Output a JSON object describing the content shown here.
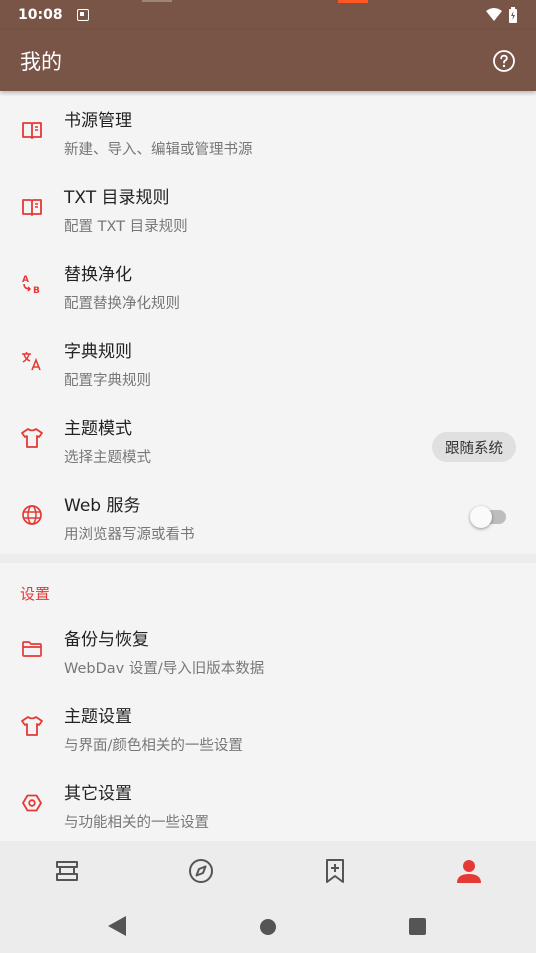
{
  "status_bar": {
    "time": "10:08"
  },
  "app_bar": {
    "title": "我的"
  },
  "rows": [
    {
      "title": "书源管理",
      "subtitle": "新建、导入、编辑或管理书源"
    },
    {
      "title": "TXT 目录规则",
      "subtitle": "配置 TXT 目录规则"
    },
    {
      "title": "替换净化",
      "subtitle": "配置替换净化规则"
    },
    {
      "title": "字典规则",
      "subtitle": "配置字典规则"
    },
    {
      "title": "主题模式",
      "subtitle": "选择主题模式",
      "chip": "跟随系统"
    },
    {
      "title": "Web 服务",
      "subtitle": "用浏览器写源或看书",
      "switch_on": false
    }
  ],
  "settings_section": {
    "header": "设置",
    "rows": [
      {
        "title": "备份与恢复",
        "subtitle": "WebDav 设置/导入旧版本数据"
      },
      {
        "title": "主题设置",
        "subtitle": "与界面/颜色相关的一些设置"
      },
      {
        "title": "其它设置",
        "subtitle": "与功能相关的一些设置"
      }
    ]
  },
  "bottom_nav": {
    "selected": "my",
    "tabs": [
      "bookshelf-icon",
      "explore-icon",
      "rss-icon",
      "person-icon"
    ]
  },
  "colors": {
    "primary": "#795548",
    "accent": "#e53935",
    "selected_tab": "#e53935"
  }
}
